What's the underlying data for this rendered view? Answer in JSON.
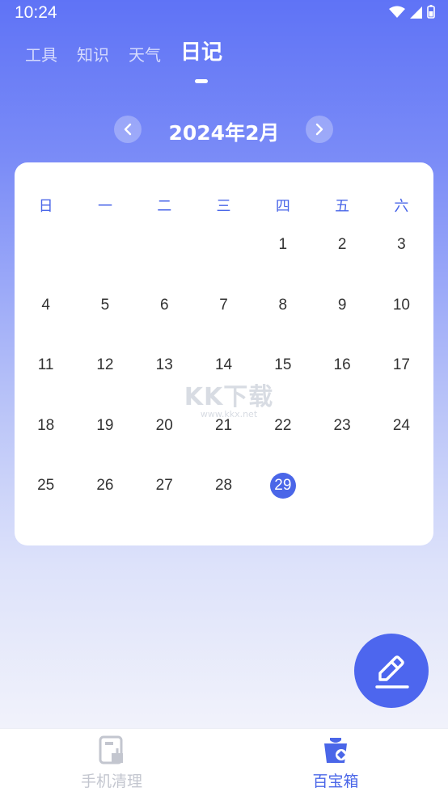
{
  "status": {
    "time": "10:24"
  },
  "tabs": [
    {
      "label": "工具"
    },
    {
      "label": "知识"
    },
    {
      "label": "天气"
    },
    {
      "label": "日记"
    }
  ],
  "calendar": {
    "month_title": "2024年2月",
    "weekdays": [
      "日",
      "一",
      "二",
      "三",
      "四",
      "五",
      "六"
    ],
    "leading_blanks": 4,
    "days_in_month": 29,
    "today": 29
  },
  "watermark": {
    "logo": "KK下载",
    "url": "www.kkx.net"
  },
  "fab": {
    "icon": "edit-pencil-icon"
  },
  "bottom_nav": {
    "items": [
      {
        "label": "手机清理",
        "icon": "phone-clean-icon",
        "active": false
      },
      {
        "label": "百宝箱",
        "icon": "treasure-box-icon",
        "active": true
      }
    ]
  },
  "colors": {
    "accent": "#4a66e8",
    "fab": "#4d66ee",
    "inactive": "#c3c6cf"
  }
}
